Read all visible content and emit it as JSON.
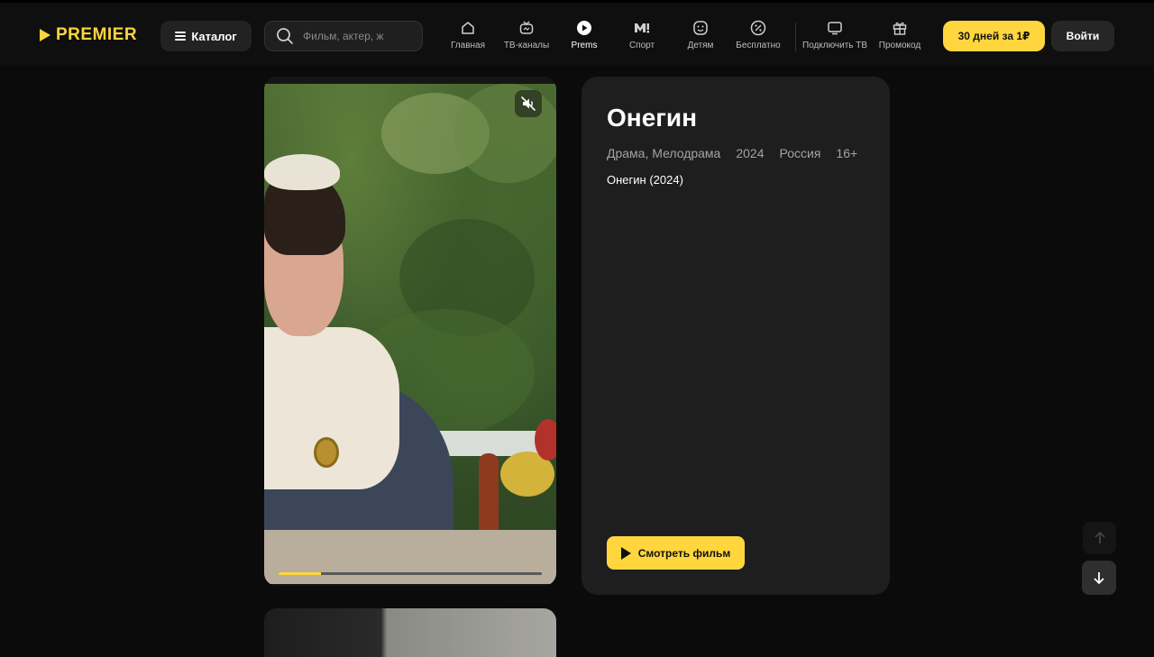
{
  "header": {
    "logo_text": "PREMIER",
    "catalog_label": "Каталог",
    "search_placeholder": "Фильм, актер, ж",
    "nav": [
      {
        "label": "Главная",
        "icon": "home-icon"
      },
      {
        "label": "ТВ-каналы",
        "icon": "tv-channels-icon"
      },
      {
        "label": "Prems",
        "icon": "play-circle-icon",
        "active": true
      },
      {
        "label": "Спорт",
        "icon": "sport-m-icon"
      },
      {
        "label": "Детям",
        "icon": "kids-smile-icon"
      },
      {
        "label": "Бесплатно",
        "icon": "percent-icon"
      },
      {
        "label": "Подключить ТВ",
        "icon": "monitor-icon"
      },
      {
        "label": "Промокод",
        "icon": "gift-icon"
      }
    ],
    "promo_button": "30 дней за 1₽",
    "login_button": "Войти"
  },
  "player": {
    "progress_fraction": 0.16
  },
  "info": {
    "title": "Онегин",
    "genres": "Драма, Мелодрама",
    "year": "2024",
    "country": "Россия",
    "age_rating": "16+",
    "subtitle": "Онегин (2024)",
    "watch_button": "Смотреть фильм"
  },
  "colors": {
    "accent": "#ffd63e",
    "background": "#0b0b0b",
    "card": "#1e1e1e"
  }
}
